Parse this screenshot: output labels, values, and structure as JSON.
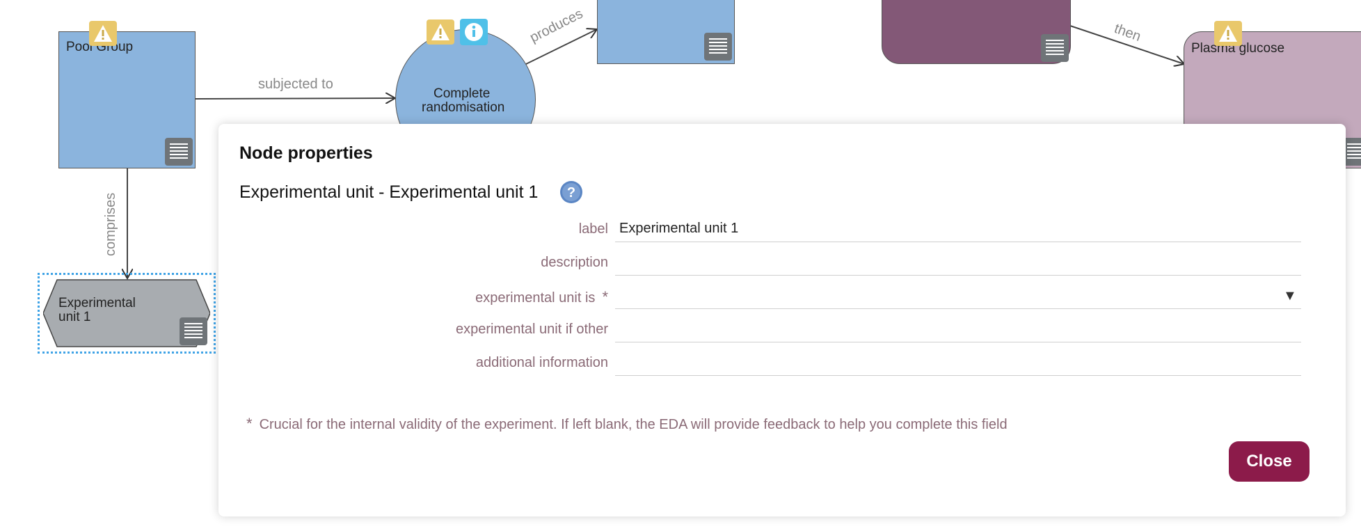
{
  "canvas": {
    "edges": {
      "subjected_to": "subjected to",
      "produces": "produces",
      "then": "then",
      "comprises": "comprises"
    },
    "nodes": {
      "pool_group": {
        "label": "Pool Group",
        "color": "#8bb4dd"
      },
      "complete_randomisation": {
        "label_line1": "Complete",
        "label_line2": "randomisation",
        "color": "#8bb4dd"
      },
      "blue_rect_top": {
        "color": "#8bb4dd"
      },
      "purple_node": {
        "color": "#835877"
      },
      "plasma_glucose": {
        "label": "Plasma glucose",
        "color": "#c3a9bc"
      },
      "experimental_unit": {
        "label_line1": "Experimental",
        "label_line2": "unit 1",
        "color": "#a8acb0"
      }
    },
    "icons": {
      "warning": "warning-icon",
      "info": "info-icon",
      "notes": "notes-icon"
    }
  },
  "dialog": {
    "title": "Node properties",
    "subtitle": "Experimental unit - Experimental unit 1",
    "fields": [
      {
        "label": "label",
        "value": "Experimental unit 1",
        "required": false
      },
      {
        "label": "description",
        "value": "",
        "required": false
      },
      {
        "label": "experimental unit is",
        "value": "",
        "required": true,
        "type": "select",
        "required_mark": "*"
      },
      {
        "label": "experimental unit if other",
        "value": "",
        "required": false
      },
      {
        "label": "additional information",
        "value": "",
        "required": false
      }
    ],
    "footnote_mark": "*",
    "footnote": "Crucial for the internal validity of the experiment. If left blank, the EDA will provide feedback to help you complete this field",
    "close_label": "Close",
    "accent_color": "#8c1b4a"
  }
}
